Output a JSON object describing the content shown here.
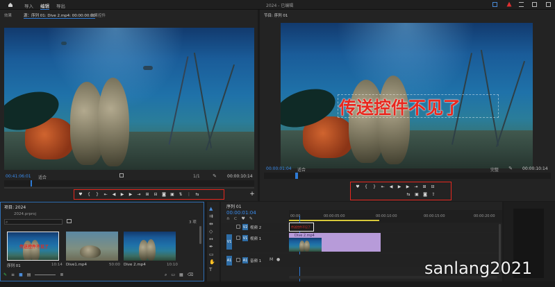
{
  "menu": {
    "home_icon": "home-icon",
    "tabs": [
      "导入",
      "编辑",
      "导出"
    ],
    "project_title": "2024 - 已编辑",
    "right_icons": [
      "share-icon",
      "alert-icon",
      "list-icon",
      "export-icon",
      "minimize-icon",
      "maximize-icon",
      "close-icon"
    ]
  },
  "source": {
    "tabs": [
      "效果",
      "源：序列 01: Dive 2.mp4: 00:00:00:00",
      "效果控件"
    ],
    "timecode_in": "00:41:06:01",
    "fit": "适合",
    "scale": "1/1",
    "timecode_out": "00:00:10:14"
  },
  "program": {
    "title": "节目: 序列 01",
    "timecode": "00:00:01:04",
    "fit": "适合",
    "quality": "完整",
    "timecode_out": "00:00:10:14",
    "overlay_text": "传送控件不见了"
  },
  "project": {
    "title": "项目: 2024",
    "file": "2024.prproj",
    "search_placeholder": "",
    "count": "3 项",
    "items": [
      {
        "name": "序列 01",
        "duration": "10:14",
        "label": "传送控件不见了"
      },
      {
        "name": "Dive1.mp4",
        "duration": "50:00"
      },
      {
        "name": "Dive 2.mp4",
        "duration": "10:10"
      }
    ]
  },
  "timeline": {
    "tab": "序列 01",
    "timecode": "00:00:01:04",
    "ruler": [
      "00:00",
      "00:00:05:00",
      "00:00:10:00",
      "00:00:15:00",
      "00:00:20:00"
    ],
    "tracks": [
      {
        "id": "V2",
        "name": "视频 2"
      },
      {
        "id": "V1",
        "name": "视频 1"
      },
      {
        "id": "A1",
        "name": "音频 1"
      }
    ],
    "clip_title": "传送控件不见了",
    "clip_v1": "Dive 2.mp4"
  },
  "watermark": "sanlang2021",
  "colors": {
    "accent": "#2e7bd6",
    "highlight": "#e8281f",
    "clip_purple": "#b79bd9"
  }
}
